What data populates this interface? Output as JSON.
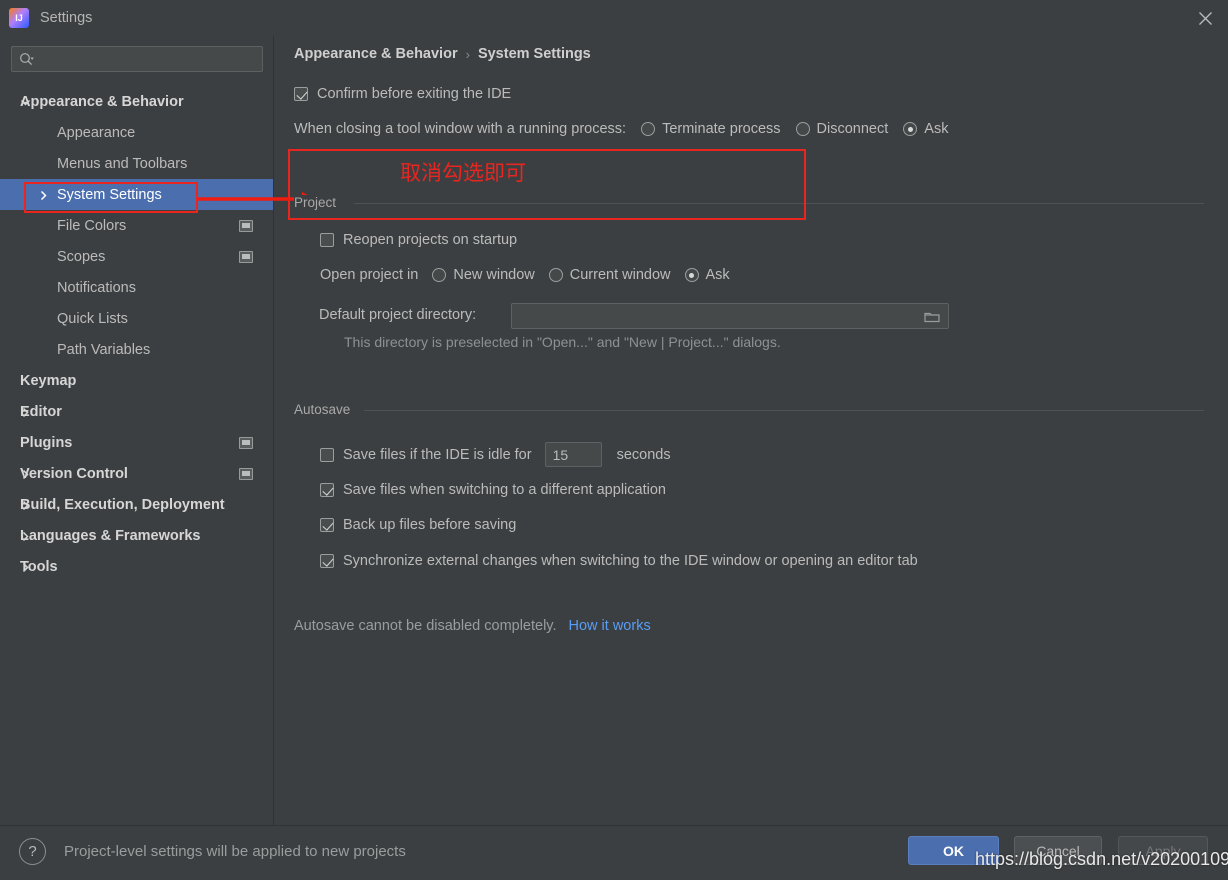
{
  "window": {
    "title": "Settings",
    "logo_icon": "intellij-idea-logo",
    "close_icon": "close-icon"
  },
  "sidebar": {
    "search": {
      "value": "",
      "placeholder": "",
      "icon": "search-icon"
    },
    "items": [
      {
        "label": "Appearance & Behavior",
        "level": "root",
        "bold": true,
        "chevron": "chevron-down-icon",
        "selected": false,
        "icon": null
      },
      {
        "label": "Appearance",
        "level": "child",
        "bold": false,
        "chevron": null,
        "selected": false,
        "icon": null
      },
      {
        "label": "Menus and Toolbars",
        "level": "child",
        "bold": false,
        "chevron": null,
        "selected": false,
        "icon": null
      },
      {
        "label": "System Settings",
        "level": "child",
        "bold": false,
        "chevron": "chevron-right-icon",
        "selected": true,
        "icon": null
      },
      {
        "label": "File Colors",
        "level": "child",
        "bold": false,
        "chevron": null,
        "selected": false,
        "icon": "monitor-icon"
      },
      {
        "label": "Scopes",
        "level": "child",
        "bold": false,
        "chevron": null,
        "selected": false,
        "icon": "monitor-icon"
      },
      {
        "label": "Notifications",
        "level": "child",
        "bold": false,
        "chevron": null,
        "selected": false,
        "icon": null
      },
      {
        "label": "Quick Lists",
        "level": "child",
        "bold": false,
        "chevron": null,
        "selected": false,
        "icon": null
      },
      {
        "label": "Path Variables",
        "level": "child",
        "bold": false,
        "chevron": null,
        "selected": false,
        "icon": null
      },
      {
        "label": "Keymap",
        "level": "root-nochev",
        "bold": true,
        "chevron": null,
        "selected": false,
        "icon": null
      },
      {
        "label": "Editor",
        "level": "root",
        "bold": true,
        "chevron": "chevron-right-icon",
        "selected": false,
        "icon": null
      },
      {
        "label": "Plugins",
        "level": "root-nochev",
        "bold": true,
        "chevron": null,
        "selected": false,
        "icon": "monitor-icon"
      },
      {
        "label": "Version Control",
        "level": "root",
        "bold": true,
        "chevron": "chevron-right-icon",
        "selected": false,
        "icon": "monitor-icon"
      },
      {
        "label": "Build, Execution, Deployment",
        "level": "root",
        "bold": true,
        "chevron": "chevron-right-icon",
        "selected": false,
        "icon": null
      },
      {
        "label": "Languages & Frameworks",
        "level": "root",
        "bold": true,
        "chevron": "chevron-right-icon",
        "selected": false,
        "icon": null
      },
      {
        "label": "Tools",
        "level": "root",
        "bold": true,
        "chevron": "chevron-right-icon",
        "selected": false,
        "icon": null
      }
    ]
  },
  "breadcrumb": {
    "parent": "Appearance & Behavior",
    "separator": "›",
    "current": "System Settings"
  },
  "main": {
    "confirm_exit": {
      "label": "Confirm before exiting the IDE",
      "checked": true
    },
    "closing_tool_window": {
      "label": "When closing a tool window with a running process:",
      "options": [
        {
          "label": "Terminate process",
          "selected": false
        },
        {
          "label": "Disconnect",
          "selected": false
        },
        {
          "label": "Ask",
          "selected": true
        }
      ]
    },
    "project_group": {
      "title": "Project",
      "reopen": {
        "label": "Reopen projects on startup",
        "checked": false
      },
      "open_project_in": {
        "label": "Open project in",
        "options": [
          {
            "label": "New window",
            "selected": false
          },
          {
            "label": "Current window",
            "selected": false
          },
          {
            "label": "Ask",
            "selected": true
          }
        ]
      },
      "default_dir": {
        "label": "Default project directory:",
        "value": "",
        "placeholder": "",
        "browse_icon": "folder-icon"
      },
      "default_dir_hint": "This directory is preselected in \"Open...\" and \"New | Project...\" dialogs."
    },
    "autosave_group": {
      "title": "Autosave",
      "idle": {
        "label": "Save files if the IDE is idle for",
        "checked": false,
        "seconds_value": "15",
        "suffix": "seconds"
      },
      "items": [
        {
          "label": "Save files when switching to a different application",
          "checked": true
        },
        {
          "label": "Back up files before saving",
          "checked": true
        },
        {
          "label": "Synchronize external changes when switching to the IDE window or opening an editor tab",
          "checked": true
        }
      ],
      "note": "Autosave cannot be disabled completely.",
      "note_link": "How it works"
    }
  },
  "bottom": {
    "help_icon": "question-mark-icon",
    "note": "Project-level settings will be applied to new projects",
    "ok": "OK",
    "cancel": "Cancel",
    "apply": "Apply"
  },
  "annotations": {
    "chinese_note": "取消勾选即可",
    "color": "#e8251f"
  },
  "watermark": {
    "text": "https://blog.csdn.net/v20200109"
  }
}
